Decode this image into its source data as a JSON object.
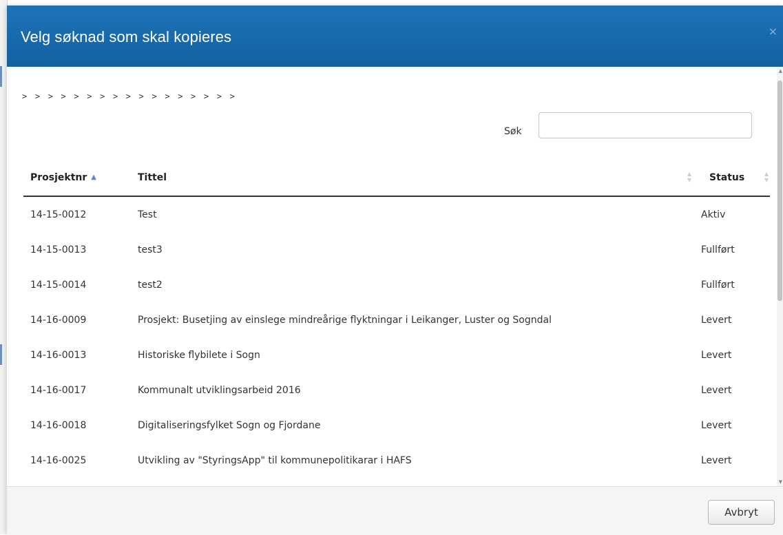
{
  "modal": {
    "title": "Velg søknad som skal kopieres",
    "close_glyph": "×"
  },
  "breadcrumb": "> > > > > > > > > > > > > > > > >",
  "search": {
    "label": "Søk",
    "value": ""
  },
  "table": {
    "columns": [
      "Prosjektnr",
      "Tittel",
      "Status"
    ],
    "sorted_column": "Prosjektnr",
    "sort_direction": "ascending",
    "rows": [
      {
        "prosjektnr": "14-15-0012",
        "tittel": "Test",
        "status": "Aktiv"
      },
      {
        "prosjektnr": "14-15-0013",
        "tittel": "test3",
        "status": "Fullført"
      },
      {
        "prosjektnr": "14-15-0014",
        "tittel": "test2",
        "status": "Fullført"
      },
      {
        "prosjektnr": "14-16-0009",
        "tittel": "Prosjekt: Busetjing av einslege mindreårige flyktningar i Leikanger, Luster og Sogndal",
        "status": "Levert"
      },
      {
        "prosjektnr": "14-16-0013",
        "tittel": "Historiske flybilete i Sogn",
        "status": "Levert"
      },
      {
        "prosjektnr": "14-16-0017",
        "tittel": "Kommunalt utviklingsarbeid 2016",
        "status": "Levert"
      },
      {
        "prosjektnr": "14-16-0018",
        "tittel": "Digitaliseringsfylket Sogn og Fjordane",
        "status": "Levert"
      },
      {
        "prosjektnr": "14-16-0025",
        "tittel": "Utvikling av \"StyringsApp\" til kommunepolitikarar i HAFS",
        "status": "Levert"
      }
    ]
  },
  "footer": {
    "cancel_label": "Avbryt"
  },
  "colors": {
    "header_blue": "#1a6aab",
    "sort_active": "#6b7fd1"
  }
}
